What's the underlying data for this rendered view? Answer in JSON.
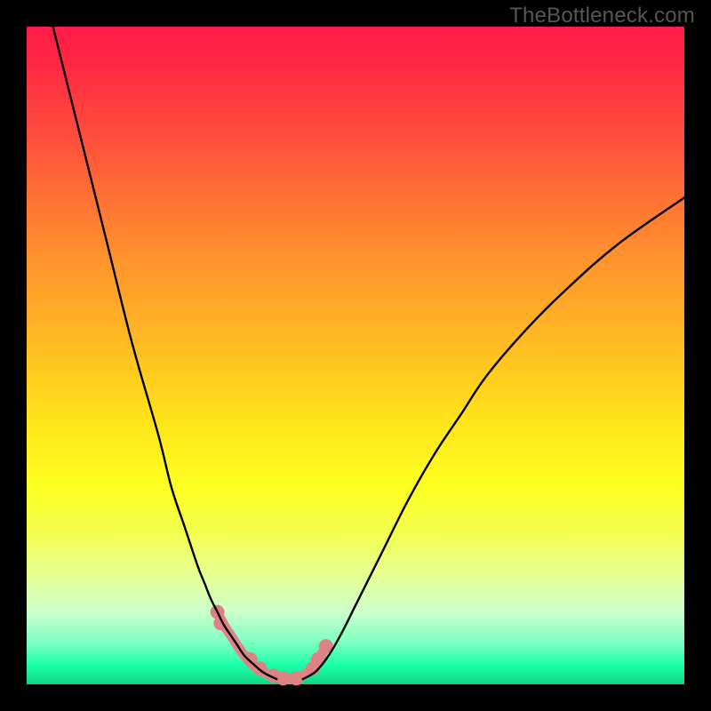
{
  "watermark": "TheBottleneck.com",
  "chart_data": {
    "type": "line",
    "title": "",
    "xlabel": "",
    "ylabel": "",
    "xlim": [
      0,
      100
    ],
    "ylim": [
      0,
      100
    ],
    "grid": false,
    "legend_position": "none",
    "gradient": {
      "direction": "vertical",
      "stops": [
        {
          "pos": 0.0,
          "color": "#ff1b48"
        },
        {
          "pos": 0.2,
          "color": "#ff5a39"
        },
        {
          "pos": 0.48,
          "color": "#ffbb23"
        },
        {
          "pos": 0.7,
          "color": "#fdff22"
        },
        {
          "pos": 0.89,
          "color": "#ccffcb"
        },
        {
          "pos": 0.97,
          "color": "#1dffab"
        },
        {
          "pos": 1.0,
          "color": "#0fd184"
        }
      ]
    },
    "series": [
      {
        "name": "left-curve",
        "type": "line",
        "x": [
          4.0,
          8.0,
          12.0,
          16.0,
          20.0,
          22.0,
          24.0,
          26.0,
          27.0,
          28.0,
          29.0,
          30.0,
          31.0,
          32.0,
          33.0,
          34.0,
          36.0,
          38.0
        ],
        "y": [
          100.0,
          84.0,
          68.0,
          52.0,
          38.0,
          30.0,
          24.0,
          18.0,
          15.5,
          13.0,
          11.0,
          9.0,
          7.5,
          6.0,
          4.5,
          3.5,
          1.8,
          0.8
        ],
        "color": "#000000",
        "width": 2.4
      },
      {
        "name": "right-curve",
        "type": "line",
        "x": [
          42.0,
          44.0,
          46.0,
          48.0,
          50.0,
          54.0,
          58.0,
          62.0,
          66.0,
          70.0,
          76.0,
          82.0,
          90.0,
          100.0
        ],
        "y": [
          0.8,
          2.0,
          4.5,
          8.0,
          12.0,
          20.0,
          28.0,
          35.0,
          41.0,
          47.0,
          54.0,
          60.0,
          67.0,
          74.0
        ],
        "color": "#000000",
        "width": 2.4
      },
      {
        "name": "floor",
        "type": "line",
        "x": [
          29.0,
          30.0,
          31.0,
          33.0,
          35.0,
          37.0,
          38.0,
          39.0,
          41.0,
          43.5,
          44.5,
          45.5
        ],
        "y": [
          11.0,
          9.0,
          7.5,
          4.5,
          2.4,
          1.4,
          1.0,
          0.9,
          0.9,
          2.4,
          4.0,
          5.8
        ],
        "color": "#e08488",
        "width": 11,
        "linecap": "round"
      },
      {
        "name": "dots",
        "type": "scatter",
        "x": [
          29.0,
          29.5,
          34.0,
          35.5,
          37.5,
          39.0,
          41.0,
          43.5,
          44.3,
          45.5
        ],
        "y": [
          11.0,
          9.3,
          3.8,
          2.4,
          1.3,
          0.9,
          0.9,
          2.4,
          3.8,
          5.8
        ],
        "color": "#de8185",
        "radius": 8
      }
    ]
  }
}
